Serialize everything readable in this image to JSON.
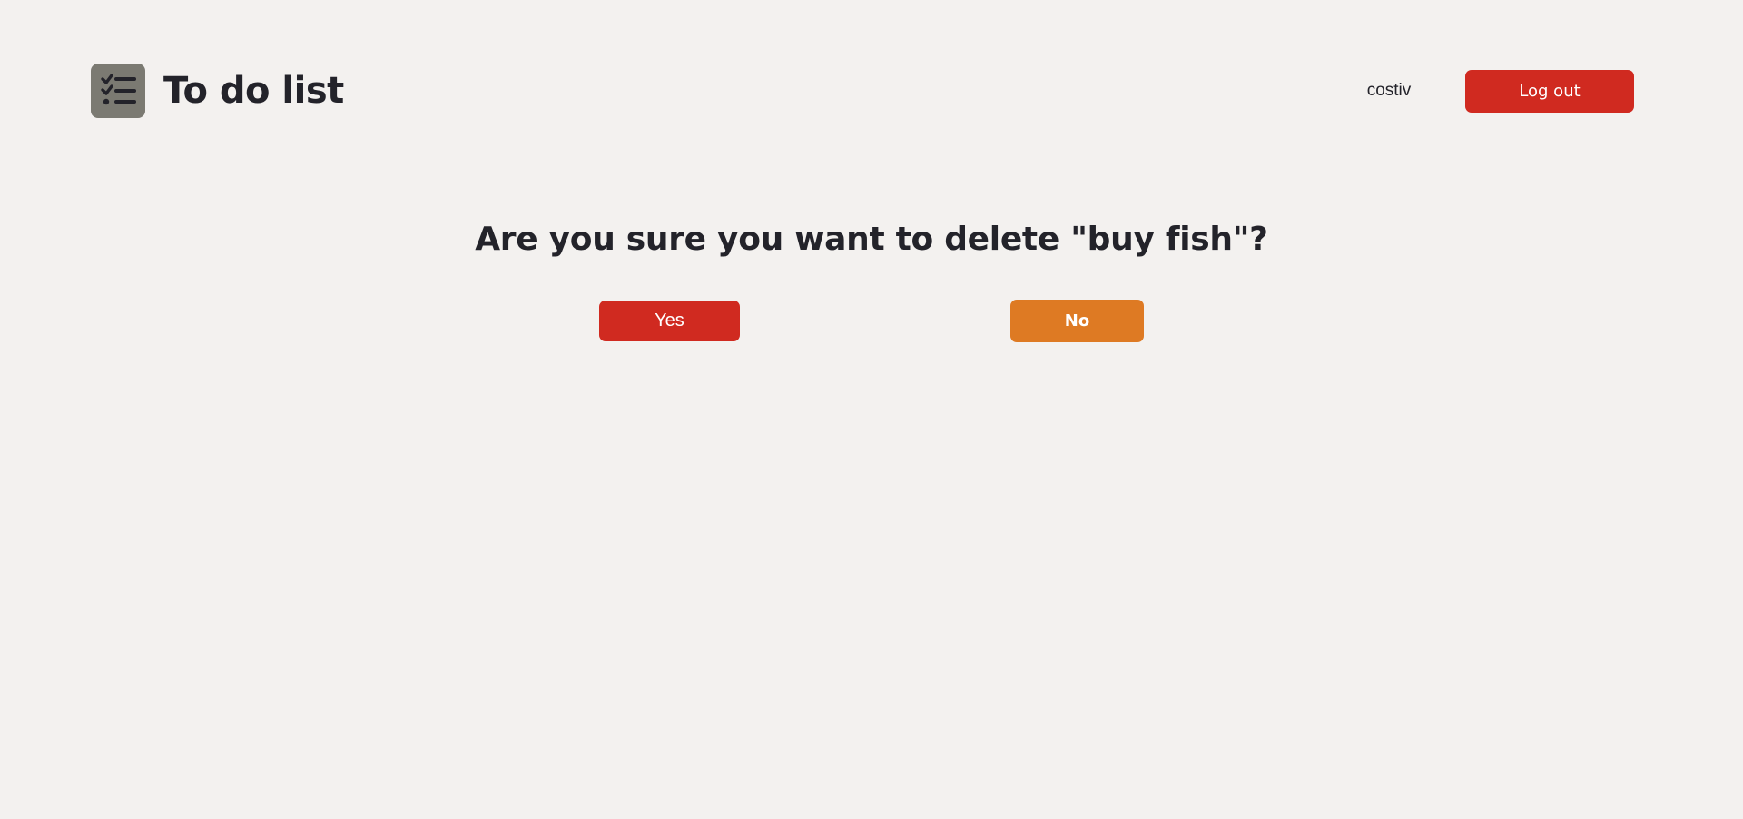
{
  "header": {
    "logo_icon": "checklist-icon",
    "app_title": "To do list",
    "username": "costiv",
    "logout_label": "Log out"
  },
  "confirm": {
    "question": "Are you sure you want to delete \"buy fish\"?",
    "yes_label": "Yes",
    "no_label": "No"
  },
  "colors": {
    "background": "#f3f1ef",
    "text": "#23232a",
    "logo_tile": "#7b7a72",
    "danger": "#d02a20",
    "warning": "#de7a23"
  }
}
